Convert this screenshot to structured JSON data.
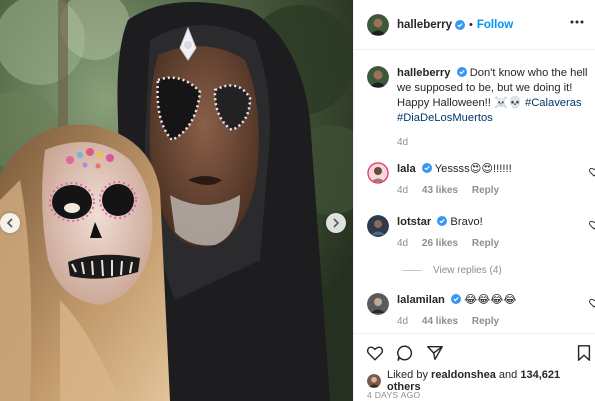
{
  "post": {
    "username": "halleberry",
    "follow_label": "Follow",
    "separator": "•",
    "caption": {
      "username": "halleberry",
      "text": "Don't know who the hell we supposed to be, but we doing it! Happy Halloween!! ☠️💀",
      "hashtags": [
        "#Calaveras",
        "#DiaDeLosMuertos"
      ],
      "age": "4d"
    },
    "comments": [
      {
        "username": "lala",
        "text": "Yessss😍😍!!!!!!",
        "age": "4d",
        "likes": "43 likes",
        "reply": "Reply"
      },
      {
        "username": "lotstar",
        "text": "Bravo!",
        "age": "4d",
        "likes": "26 likes",
        "reply": "Reply"
      },
      {
        "username": "lalamilan",
        "text": "😂😂😂😂",
        "age": "4d",
        "likes": "44 likes",
        "reply": "Reply"
      }
    ],
    "view_replies": "View replies (4)",
    "liked_by": {
      "prefix": "Liked by",
      "user": "realdonshea",
      "conj": "and",
      "count": "134,621 others"
    },
    "date": "4 DAYS AGO"
  },
  "icons": {
    "verified": "verified-badge-icon",
    "more": "more-options-icon",
    "heart": "heart-icon",
    "comment": "comment-icon",
    "share": "share-icon",
    "save": "bookmark-icon",
    "prev": "chevron-left-icon",
    "next": "chevron-right-icon"
  },
  "colors": {
    "link": "#0095f6",
    "hashtag": "#00376b",
    "muted": "#8e8e8e",
    "verified": "#3897f0"
  }
}
